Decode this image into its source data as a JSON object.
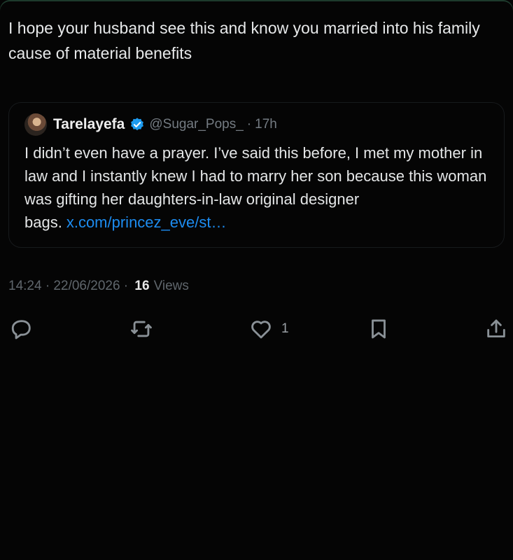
{
  "tweet": {
    "text": "I hope your husband see this and know you married into his family cause of material benefits"
  },
  "quoted_tweet": {
    "display_name": "Tarelayefa",
    "handle": "@Sugar_Pops_",
    "separator": "·",
    "age": "17h",
    "text": "I didn’t even have a prayer. I’ve said this before, I met my mother in law and I instantly knew I had to marry her son because this woman was gifting her daughters-in-law original designer bags.",
    "link": "x.com/princez_eve/st…",
    "verified_color": "#1d9bf0"
  },
  "meta": {
    "timestamp": "14:24 · 22/06/2026 ·",
    "views_count": "16",
    "views_label": "Views"
  },
  "actions": {
    "reply_icon": "reply-icon",
    "retweet_icon": "retweet-icon",
    "like_icon": "heart-icon",
    "like_count": "1",
    "bookmark_icon": "bookmark-icon",
    "share_icon": "share-icon"
  },
  "colors": {
    "background": "#050505",
    "text": "#e7e9ea",
    "muted": "#747b82",
    "link": "#1d8cf0"
  }
}
